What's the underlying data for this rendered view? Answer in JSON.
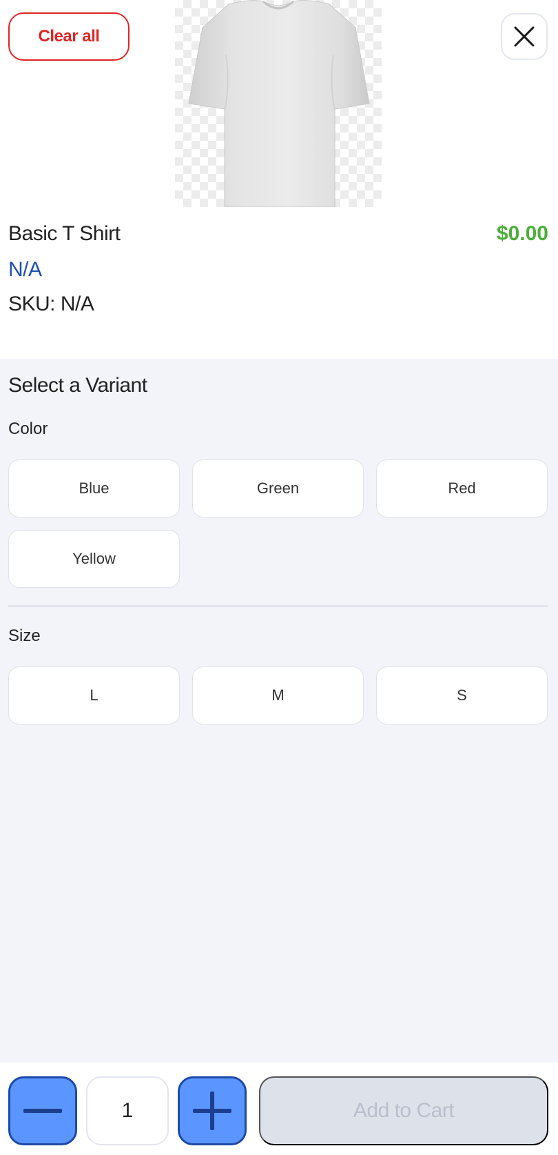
{
  "header": {
    "clear_all_label": "Clear all"
  },
  "product": {
    "name": "Basic T Shirt",
    "price": "$0.00",
    "subtitle": "N/A",
    "sku": "SKU: N/A"
  },
  "variants": {
    "title": "Select a Variant",
    "groups": [
      {
        "label": "Color",
        "options": [
          "Blue",
          "Green",
          "Red",
          "Yellow"
        ]
      },
      {
        "label": "Size",
        "options": [
          "L",
          "M",
          "S"
        ]
      }
    ]
  },
  "footer": {
    "quantity": "1",
    "add_to_cart_label": "Add to Cart"
  },
  "colors": {
    "danger": "#e02424",
    "price": "#4caf3a",
    "link": "#1e50b4",
    "primary": "#5b95ff",
    "primary_border": "#1d4aa8",
    "disabled_bg": "#dde1ea",
    "disabled_text": "#b9bfcc",
    "panel_bg": "#f2f4f9"
  },
  "icons": {
    "close": "close-icon",
    "minus": "minus-icon",
    "plus": "plus-icon",
    "product": "t-shirt-image"
  }
}
